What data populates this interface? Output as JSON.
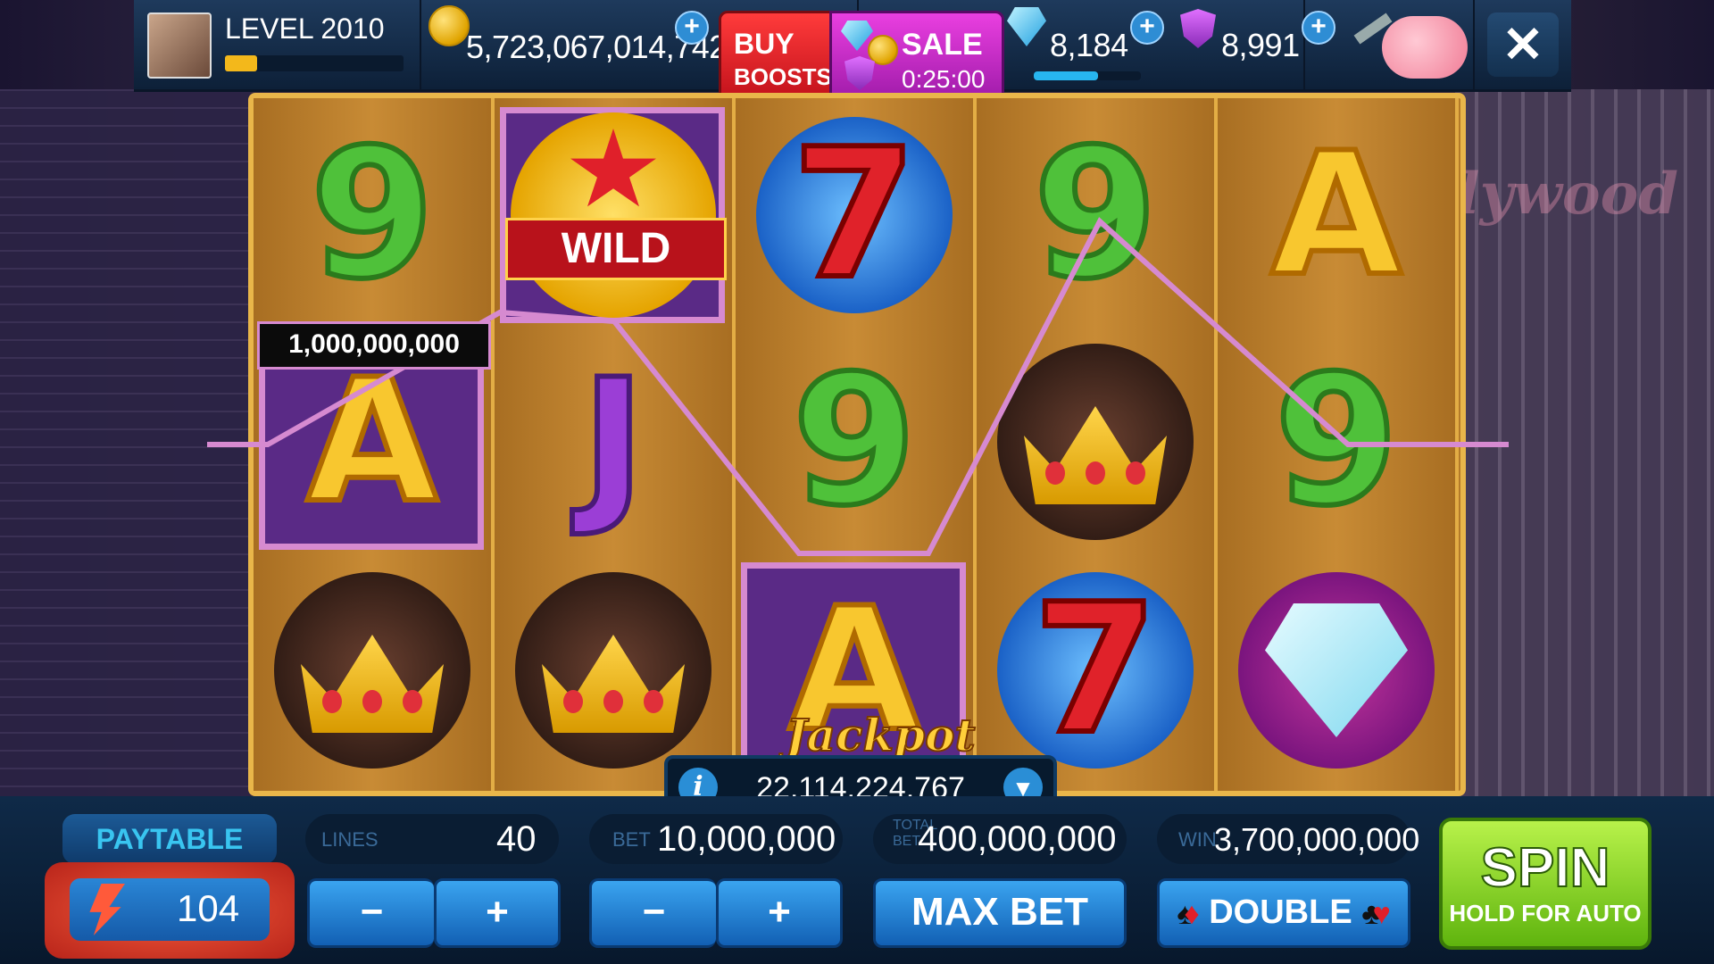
{
  "header": {
    "level": "LEVEL 2010",
    "xp_fraction": 0.18,
    "coins": "5,723,067,014,742",
    "buy_line1": "BUY",
    "buy_line2": "BOOSTS",
    "sale_label": "SALE",
    "sale_timer": "0:25:00",
    "gems": "8,184",
    "gem_bar_fraction": 0.6,
    "shields": "8,991"
  },
  "reels": [
    [
      "9",
      "A",
      "crown"
    ],
    [
      "wild",
      "J",
      "crown"
    ],
    [
      "7",
      "9",
      "A"
    ],
    [
      "9",
      "crown",
      "7"
    ],
    [
      "A",
      "9",
      "diamond"
    ]
  ],
  "wild_text": "WILD",
  "win_label": "1,000,000,000",
  "jackpot": {
    "label": "Jackpot",
    "value": "22,114,224,767"
  },
  "controls": {
    "paytable": "PAYTABLE",
    "boost_count": "104",
    "lines_label": "LINES",
    "lines_value": "40",
    "bet_label": "BET",
    "bet_value": "10,000,000",
    "total_label": "TOTAL BET",
    "total_value": "400,000,000",
    "win_label": "WIN",
    "win_value": "3,700,000,000",
    "minus": "−",
    "plus": "+",
    "max_bet": "MAX BET",
    "double": "DOUBLE",
    "spin": "SPIN",
    "spin_sub": "HOLD FOR AUTO",
    "hollywood": "llywood"
  },
  "colors": {
    "payline": "#d68ad0",
    "spin_green": "#7bd21a",
    "buy_red": "#e0202a",
    "sale_magenta": "#c22fd0"
  }
}
